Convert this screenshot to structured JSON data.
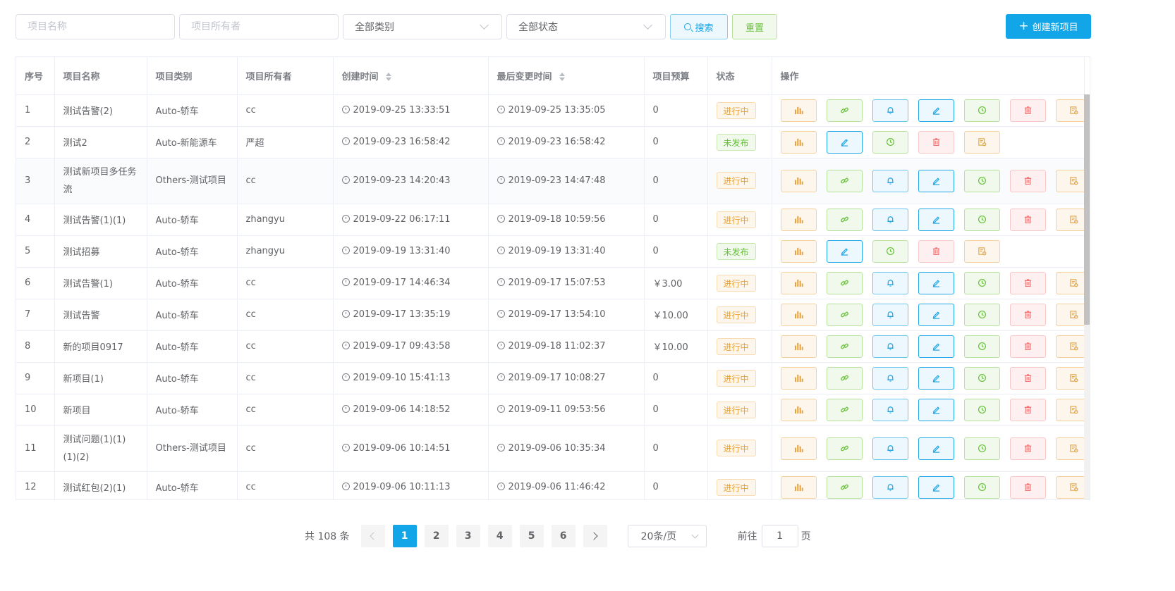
{
  "filters": {
    "name_placeholder": "项目名称",
    "owner_placeholder": "项目所有者",
    "category_value": "全部类别",
    "status_value": "全部状态",
    "search_label": "搜索",
    "reset_label": "重置",
    "create_label": "创建新项目"
  },
  "table": {
    "headers": {
      "index": "序号",
      "name": "项目名称",
      "category": "项目类别",
      "owner": "项目所有者",
      "created": "创建时间",
      "modified": "最后变更时间",
      "budget": "项目预算",
      "status": "状态",
      "actions": "操作"
    },
    "rows": [
      {
        "index": "1",
        "name": "测试告警(2)",
        "category": "Auto-轿车",
        "owner": "cc",
        "created": "2019-09-25 13:33:51",
        "modified": "2019-09-25 13:35:05",
        "budget": "0",
        "status": "进行中",
        "status_type": "progress"
      },
      {
        "index": "2",
        "name": "测试2",
        "category": "Auto-新能源车",
        "owner": "严超",
        "created": "2019-09-23 16:58:42",
        "modified": "2019-09-23 16:58:42",
        "budget": "0",
        "status": "未发布",
        "status_type": "draft"
      },
      {
        "index": "3",
        "name": "测试新项目多任务流",
        "category": "Others-测试项目",
        "owner": "cc",
        "created": "2019-09-23 14:20:43",
        "modified": "2019-09-23 14:47:48",
        "budget": "0",
        "status": "进行中",
        "status_type": "progress"
      },
      {
        "index": "4",
        "name": "测试告警(1)(1)",
        "category": "Auto-轿车",
        "owner": "zhangyu",
        "created": "2019-09-22 06:17:11",
        "modified": "2019-09-18 10:59:56",
        "budget": "0",
        "status": "进行中",
        "status_type": "progress"
      },
      {
        "index": "5",
        "name": "测试招募",
        "category": "Auto-轿车",
        "owner": "zhangyu",
        "created": "2019-09-19 13:31:40",
        "modified": "2019-09-19 13:31:40",
        "budget": "0",
        "status": "未发布",
        "status_type": "draft"
      },
      {
        "index": "6",
        "name": "测试告警(1)",
        "category": "Auto-轿车",
        "owner": "cc",
        "created": "2019-09-17 14:46:34",
        "modified": "2019-09-17 15:07:53",
        "budget": "￥3.00",
        "status": "进行中",
        "status_type": "progress"
      },
      {
        "index": "7",
        "name": "测试告警",
        "category": "Auto-轿车",
        "owner": "cc",
        "created": "2019-09-17 13:35:19",
        "modified": "2019-09-17 13:54:10",
        "budget": "￥10.00",
        "status": "进行中",
        "status_type": "progress"
      },
      {
        "index": "8",
        "name": "新的项目0917",
        "category": "Auto-轿车",
        "owner": "cc",
        "created": "2019-09-17 09:43:58",
        "modified": "2019-09-18 11:02:37",
        "budget": "￥10.00",
        "status": "进行中",
        "status_type": "progress"
      },
      {
        "index": "9",
        "name": "新项目(1)",
        "category": "Auto-轿车",
        "owner": "cc",
        "created": "2019-09-10 15:41:13",
        "modified": "2019-09-17 10:08:27",
        "budget": "0",
        "status": "进行中",
        "status_type": "progress"
      },
      {
        "index": "10",
        "name": "新项目",
        "category": "Auto-轿车",
        "owner": "cc",
        "created": "2019-09-06 14:18:52",
        "modified": "2019-09-11 09:53:56",
        "budget": "0",
        "status": "进行中",
        "status_type": "progress"
      },
      {
        "index": "11",
        "name": "测试问题(1)(1)(1)(2)",
        "category": "Others-测试项目",
        "owner": "cc",
        "created": "2019-09-06 10:14:51",
        "modified": "2019-09-06 10:35:34",
        "budget": "0",
        "status": "进行中",
        "status_type": "progress"
      },
      {
        "index": "12",
        "name": "测试红包(2)(1)",
        "category": "Auto-轿车",
        "owner": "cc",
        "created": "2019-09-06 10:11:13",
        "modified": "2019-09-06 11:46:42",
        "budget": "0",
        "status": "进行中",
        "status_type": "progress"
      }
    ],
    "actions_progress": [
      "chart-icon",
      "link-icon",
      "bell-icon",
      "edit-icon",
      "history-icon",
      "delete-icon",
      "report-icon"
    ],
    "actions_draft": [
      "chart-icon",
      "edit-icon",
      "history-icon",
      "delete-icon",
      "report-icon"
    ]
  },
  "pagination": {
    "total_text": "共 108 条",
    "pages": [
      "1",
      "2",
      "3",
      "4",
      "5",
      "6"
    ],
    "current_page": "1",
    "page_size": "20条/页",
    "goto_prefix": "前往",
    "goto_value": "1",
    "goto_suffix": "页"
  },
  "colors": {
    "primary": "#12a6e9",
    "progress": "#e6a23c",
    "draft": "#67c23a",
    "danger": "#f56c6c"
  }
}
